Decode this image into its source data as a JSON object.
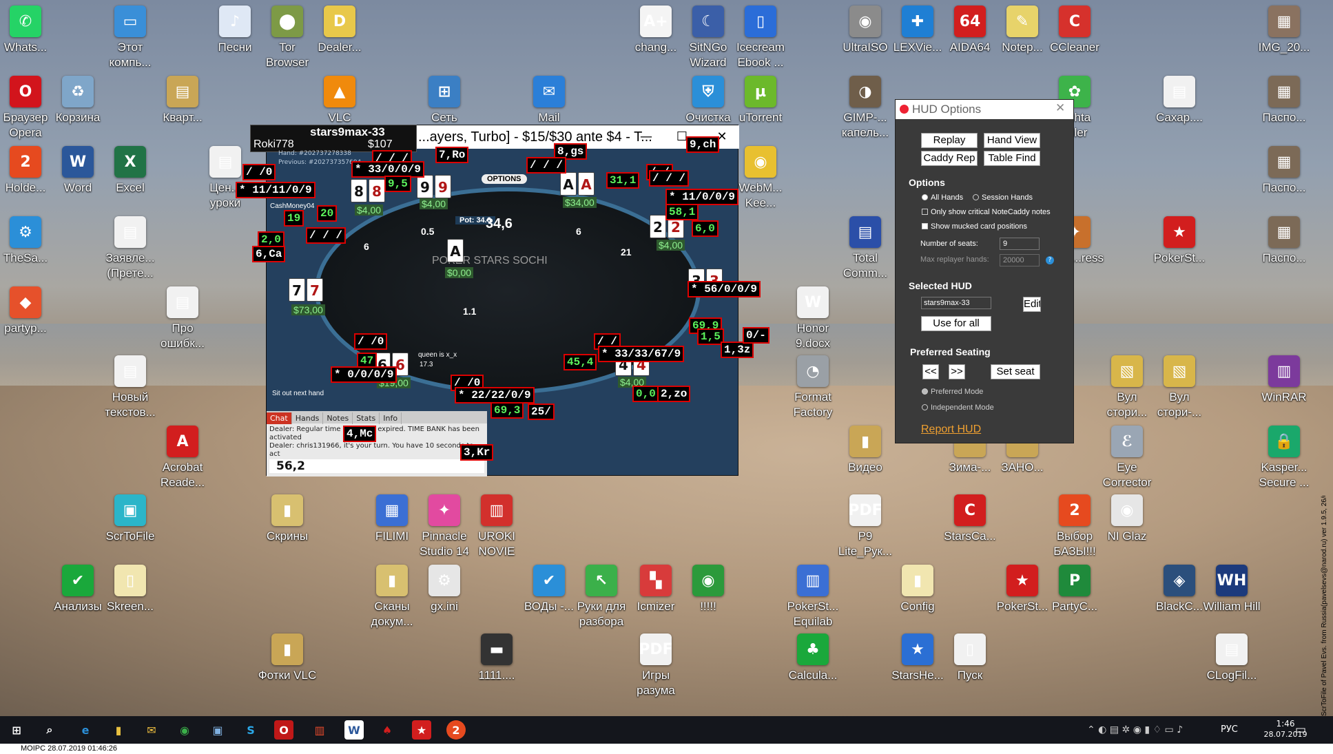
{
  "desktop_icons": [
    {
      "label": "Whats...",
      "glyph": "✆",
      "color": "#25d366"
    },
    {
      "label": "Этот компь...",
      "glyph": "▭",
      "color": "#3a8fd8"
    },
    {
      "label": "Песни",
      "glyph": "♪",
      "color": "#dfe8f5"
    },
    {
      "label": "Tor Browser",
      "glyph": "⬤",
      "color": "#7d9a46"
    },
    {
      "label": "Dealer...",
      "glyph": "D",
      "color": "#e8c84a"
    },
    {
      "label": "chang...",
      "glyph": "A+",
      "color": "#f4f4f4"
    },
    {
      "label": "SitNGo Wizard",
      "glyph": "☾",
      "color": "#3b5fa8"
    },
    {
      "label": "Icecream Ebook ...",
      "glyph": "▯",
      "color": "#2b6dd8"
    },
    {
      "label": "UltraISO",
      "glyph": "◉",
      "color": "#8b8b8b"
    },
    {
      "label": "LEXVie...",
      "glyph": "✚",
      "color": "#1f7fd4"
    },
    {
      "label": "AIDA64",
      "glyph": "64",
      "color": "#d21e1e"
    },
    {
      "label": "Notep...",
      "glyph": "✎",
      "color": "#e7d36a"
    },
    {
      "label": "CCleaner",
      "glyph": "C",
      "color": "#d6312c"
    },
    {
      "label": "IMG_20...",
      "glyph": "▦",
      "color": "#8a7260"
    },
    {
      "label": "Браузер Opera",
      "glyph": "O",
      "color": "#d2141c"
    },
    {
      "label": "Корзина",
      "glyph": "♻",
      "color": "#7fa6c9"
    },
    {
      "label": "Кварт...",
      "glyph": "▤",
      "color": "#c9a656"
    },
    {
      "label": "VLC",
      "glyph": "▲",
      "color": "#f08a0c"
    },
    {
      "label": "Сеть",
      "glyph": "⊞",
      "color": "#3b7fc4"
    },
    {
      "label": "Mail",
      "glyph": "✉",
      "color": "#2b7fd8"
    },
    {
      "label": "Очистка",
      "glyph": "⛨",
      "color": "#2b8fd8"
    },
    {
      "label": "uTorrent",
      "glyph": "µ",
      "color": "#6cb92b"
    },
    {
      "label": "GIMP-... капель...",
      "glyph": "◑",
      "color": "#6f5e4a"
    },
    {
      "label": "...chta ...iler",
      "glyph": "✿",
      "color": "#3db34a"
    },
    {
      "label": "Сахар....",
      "glyph": "▤",
      "color": "#f1f1f1"
    },
    {
      "label": "Паспо...",
      "glyph": "▦",
      "color": "#7c6a57"
    },
    {
      "label": "Holde...",
      "glyph": "2",
      "color": "#e64a1f"
    },
    {
      "label": "Word",
      "glyph": "W",
      "color": "#2b579a"
    },
    {
      "label": "Excel",
      "glyph": "X",
      "color": "#217346"
    },
    {
      "label": "Цен... уроки",
      "glyph": "▤",
      "color": "#f1f1f1"
    },
    {
      "label": "WebM... Kee...",
      "glyph": "◉",
      "color": "#e8c030"
    },
    {
      "label": "Паспо...",
      "glyph": "▦",
      "color": "#7c6a57"
    },
    {
      "label": "TheSa...",
      "glyph": "⚙",
      "color": "#2b8fd8"
    },
    {
      "label": "Заявле... (Прете...",
      "glyph": "▤",
      "color": "#f1f1f1"
    },
    {
      "label": "Total Comm...",
      "glyph": "▤",
      "color": "#2b4fa8"
    },
    {
      "label": "...ро ...ress",
      "glyph": "✦",
      "color": "#c8702c"
    },
    {
      "label": "PokerSt...",
      "glyph": "★",
      "color": "#d21e1e"
    },
    {
      "label": "Паспо...",
      "glyph": "▦",
      "color": "#7c6a57"
    },
    {
      "label": "partyp...",
      "glyph": "◆",
      "color": "#e6512b"
    },
    {
      "label": "Про ошибк...",
      "glyph": "▤",
      "color": "#f1f1f1"
    },
    {
      "label": "Honor 9.docx",
      "glyph": "W",
      "color": "#f1f1f1"
    },
    {
      "label": "Новый текстов...",
      "glyph": "▤",
      "color": "#f1f1f1"
    },
    {
      "label": "Format Factory",
      "glyph": "◔",
      "color": "#9aa0a6"
    },
    {
      "label": "Вул стори...",
      "glyph": "▧",
      "color": "#d8b64a"
    },
    {
      "label": "Вул стори-...",
      "glyph": "▧",
      "color": "#d8b64a"
    },
    {
      "label": "WinRAR",
      "glyph": "▥",
      "color": "#7c3a9c"
    },
    {
      "label": "Acrobat Reade...",
      "glyph": "A",
      "color": "#d21e1e"
    },
    {
      "label": "Видео",
      "glyph": "▮",
      "color": "#c9a656"
    },
    {
      "label": "Зима-...",
      "glyph": "",
      "color": "#c9a656"
    },
    {
      "label": "ЗАНО...",
      "glyph": "",
      "color": "#c9a656"
    },
    {
      "label": "Eye Corrector",
      "glyph": "ℰ",
      "color": "#9aa6b4"
    },
    {
      "label": "Kasper... Secure ...",
      "glyph": "🔒",
      "color": "#1aa86b"
    },
    {
      "label": "ScrToFile",
      "glyph": "▣",
      "color": "#2bb5c9"
    },
    {
      "label": "Скрины",
      "glyph": "▮",
      "color": "#d8c070"
    },
    {
      "label": "FILIMI",
      "glyph": "▦",
      "color": "#3b6fd4"
    },
    {
      "label": "Pinnacle Studio 14",
      "glyph": "✦",
      "color": "#e24aa0"
    },
    {
      "label": "UROKI NOVIE",
      "glyph": "▥",
      "color": "#d2302c"
    },
    {
      "label": "P9 Lite_Рук...",
      "glyph": "PDF",
      "color": "#f1f1f1"
    },
    {
      "label": "StarsCa...",
      "glyph": "C",
      "color": "#d21e1e"
    },
    {
      "label": "Выбор БАЗЫ!!!",
      "glyph": "2",
      "color": "#e64a1f"
    },
    {
      "label": "NI Glaz",
      "glyph": "◉",
      "color": "#e6e6e6"
    },
    {
      "label": "Анализы",
      "glyph": "✔",
      "color": "#1aa83b"
    },
    {
      "label": "Skreen...",
      "glyph": "▯",
      "color": "#f1e6b0"
    },
    {
      "label": "Сканы докум...",
      "glyph": "▮",
      "color": "#d8c070"
    },
    {
      "label": "gx.ini",
      "glyph": "⚙",
      "color": "#e6e6e6"
    },
    {
      "label": "ВОДы -...",
      "glyph": "✔",
      "color": "#2b8fd8"
    },
    {
      "label": "Руки для разбора",
      "glyph": "↖",
      "color": "#3bb04a"
    },
    {
      "label": "Icmizer",
      "glyph": "▚",
      "color": "#d83b3b"
    },
    {
      "label": "!!!!!",
      "glyph": "◉",
      "color": "#2b9a3b"
    },
    {
      "label": "PokerSt... Equilab",
      "glyph": "▥",
      "color": "#3b6fd4"
    },
    {
      "label": "Config",
      "glyph": "▮",
      "color": "#f1e6b0"
    },
    {
      "label": "PokerSt...",
      "glyph": "★",
      "color": "#d21e1e"
    },
    {
      "label": "PartyC...",
      "glyph": "P",
      "color": "#1f8a3b"
    },
    {
      "label": "BlackC...",
      "glyph": "◈",
      "color": "#2b4f7c"
    },
    {
      "label": "William Hill",
      "glyph": "WH",
      "color": "#1c3a7c"
    },
    {
      "label": "Фотки VLC",
      "glyph": "▮",
      "color": "#c9a656"
    },
    {
      "label": "1111....",
      "glyph": "▬",
      "color": "#333"
    },
    {
      "label": "Игры разума",
      "glyph": "PDF",
      "color": "#f1f1f1"
    },
    {
      "label": "Calcula...",
      "glyph": "♣",
      "color": "#1aa83b"
    },
    {
      "label": "StarsHe...",
      "glyph": "★",
      "color": "#2b6fd4"
    },
    {
      "label": "Пуск",
      "glyph": "▯",
      "color": "#f1f1f1"
    },
    {
      "label": "CLogFil...",
      "glyph": "▤",
      "color": "#f1f1f1"
    }
  ],
  "poker": {
    "title": "...ayers, Turbo] - $15/$30 ante $4 - T...",
    "hero_name": "stars9max-33",
    "player_name": "Roki778",
    "player_stack": "$107",
    "hand_label": "Hand: #202737278338",
    "previous_label": "Previous: #202737357604",
    "pot_label": "Pot: 34.6",
    "options_label": "OPTIONS",
    "center_pot": "34,6",
    "small_vals": [
      "0.5",
      "6",
      "21",
      "6",
      "1.1"
    ],
    "brand": "POKER STARS SOCHI",
    "cashmoney": "CashMoney04",
    "board_chip": "$0,00",
    "seat_stacks": [
      "$73,00",
      "$4,00",
      "$4,00",
      "$34,00",
      "$4,00",
      "$19,00",
      "$4,00"
    ],
    "sit_out": "Sit out next hand",
    "chat_tabs": [
      "Chat",
      "Hands",
      "Notes",
      "Stats",
      "Info"
    ],
    "chat_lines": [
      "Dealer: Regular time for ... has expired. TIME BANK has been activated",
      "Dealer: chris131966, it's your turn. You have 10 seconds to act"
    ],
    "chat_input": "56,2",
    "queen_label": "queen is x_x",
    "queen_val": "17.3",
    "hud_labels": [
      "7,Ro",
      "8,gs",
      "9,ch",
      "/ /0",
      "/ / /",
      "* 33/0/0/9",
      "9,5",
      "* 11/11/0/9",
      "20",
      "19",
      "/ / /",
      "/ /",
      "31,1",
      "/ / /",
      "* 11/0/0/9",
      "58,1",
      "6,0",
      "2,0",
      "6,Ca",
      "/ / /",
      "* 56/0/0/9",
      "69,9",
      "1,5",
      "1,3z",
      "0/-",
      "/ /0",
      "47",
      "* 0/0/0/9",
      "/ /",
      "* 33/33/67/9",
      "45,4",
      "0,0",
      "2,zo",
      "/ /0",
      "* 22/22/0/9",
      "69,3",
      "25/",
      "4,Mc",
      "3,Kr"
    ]
  },
  "hud_options": {
    "title": "HUD Options",
    "buttons": [
      "Replay",
      "Hand View",
      "Caddy Rep",
      "Table Find"
    ],
    "options_head": "Options",
    "radio_all": "All Hands",
    "radio_session": "Session Hands",
    "check_notes": "Only show critical NoteCaddy notes",
    "check_mucked": "Show mucked card positions",
    "seats_label": "Number of seats:",
    "seats_value": "9",
    "replayer_label": "Max replayer hands:",
    "replayer_value": "20000",
    "selected_head": "Selected HUD",
    "selected_value": "stars9max-33",
    "edit_btn": "Edit",
    "use_all_btn": "Use for all similar",
    "pref_head": "Preferred Seating",
    "prev_btn": "<<",
    "next_btn": ">>",
    "set_seat_btn": "Set seat",
    "pref_mode": "Preferred Mode",
    "indep_mode": "Independent Mode",
    "report_link": "Report HUD"
  },
  "taskbar": {
    "lang": "РУС",
    "time": "1:46",
    "date": "28.07.2019"
  },
  "bottom_strip": "MOIPC 28.07.2019 01:46:26",
  "side_text": "ScrToFile of Pavel Evs. from Russia(pavelsevs@narod.ru) ver 1.9.5, 26/08/2008",
  "colors": {
    "accent": "#d00000",
    "hud_green": "#5cf25c",
    "report": "#f0a030"
  }
}
